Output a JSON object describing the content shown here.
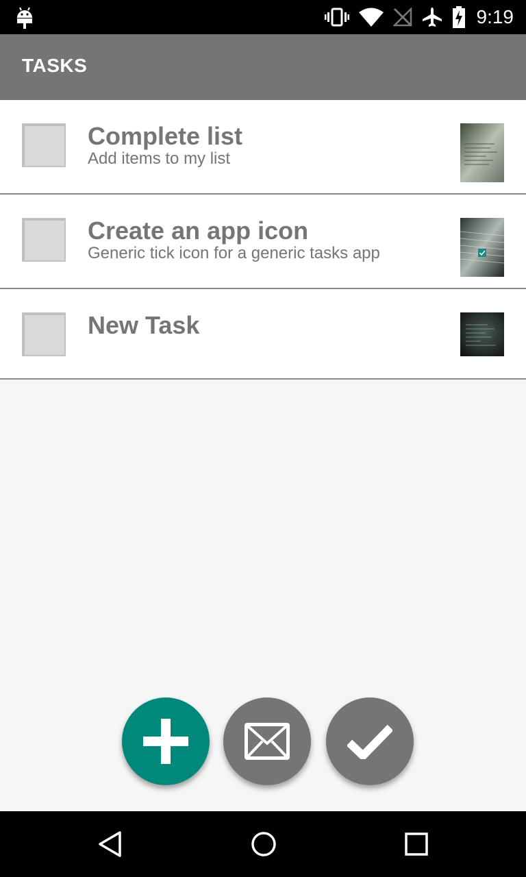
{
  "status_bar": {
    "time": "9:19",
    "icons": [
      "android-icon",
      "vibrate-icon",
      "wifi-icon",
      "no-signal-icon",
      "airplane-icon",
      "battery-charging-icon"
    ]
  },
  "toolbar": {
    "title": "TASKS"
  },
  "tasks": [
    {
      "title": "Complete list",
      "description": "Add items to my list",
      "checked": false
    },
    {
      "title": "Create an app icon",
      "description": "Generic tick icon for a generic tasks app",
      "checked": false
    },
    {
      "title": "New Task",
      "description": "",
      "checked": false
    }
  ],
  "fabs": [
    {
      "name": "add-task-button",
      "icon": "plus-icon",
      "color": "#00897b"
    },
    {
      "name": "email-button",
      "icon": "mail-icon",
      "color": "#757575"
    },
    {
      "name": "complete-button",
      "icon": "check-icon",
      "color": "#757575"
    }
  ],
  "nav_bar": {
    "icons": [
      "back-icon",
      "home-icon",
      "recents-icon"
    ]
  },
  "colors": {
    "toolbar": "#757575",
    "accent": "#00897b",
    "text": "#757575",
    "background": "#f6f6f6"
  }
}
